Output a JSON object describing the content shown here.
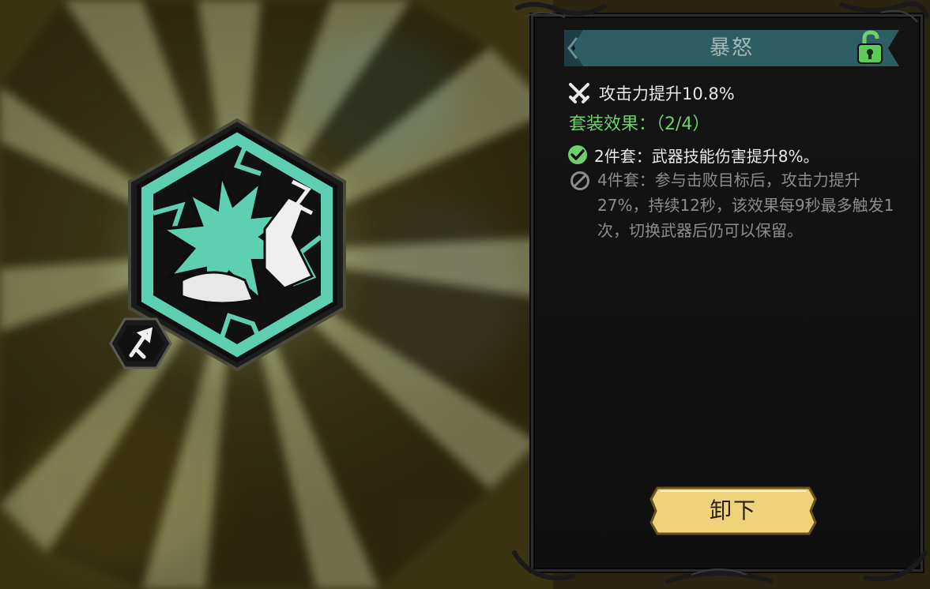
{
  "panel": {
    "title": "暴怒",
    "lock_icon": "unlocked-padlock-icon",
    "stat": {
      "icon": "crossed-swords-icon",
      "text": "攻击力提升10.8%"
    },
    "set_effect": {
      "label": "套装效果：（2/4）"
    },
    "bonuses": [
      {
        "icon": "check-circle-icon",
        "text": "2件套：武器技能伤害提升8%。",
        "active": true
      },
      {
        "icon": "disabled-circle-icon",
        "text": "4件套：参与击败目标后，攻击力提升27%，持续12秒，该效果每9秒最多触发1次，切换武器后仍可以保留。",
        "active": false
      }
    ],
    "unequip_label": "卸下"
  },
  "emblem": {
    "icon": "rage-spiked-emblem-icon",
    "sub_badge_icon": "weapon-type-icon"
  },
  "colors": {
    "accent_teal": "#5fcfb2",
    "title_bar": "#2e5d63",
    "set_green": "#6fcf6a",
    "button_gold": "#f0d27a",
    "panel_bg": "#131313"
  }
}
